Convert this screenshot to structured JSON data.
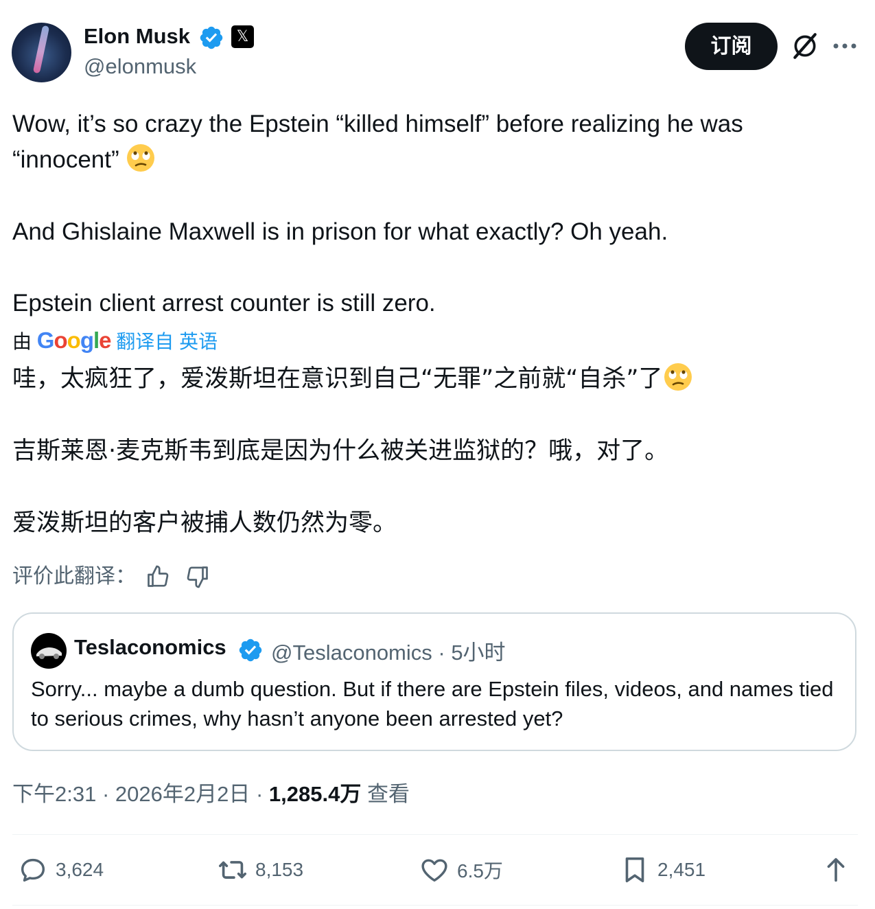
{
  "author": {
    "name": "Elon Musk",
    "handle": "@elonmusk",
    "subscribe_label": "订阅"
  },
  "tweet": {
    "line1": "Wow, it’s so crazy the Epstein “killed himself” before realizing he was",
    "line2": "“innocent”",
    "line3": "And Ghislaine Maxwell is in prison for what exactly? Oh yeah.",
    "line4": "Epstein client arrest counter is still zero."
  },
  "translation": {
    "by": "由",
    "provider": "Google",
    "link": "翻译自 英语",
    "line1": "哇，太疯狂了，爱泼斯坦在意识到自己“无罪”之前就“自杀”了",
    "line2": "吉斯莱恩·麦克斯韦到底是因为什么被关进监狱的？哦，对了。",
    "line3": "爱泼斯坦的客户被捕人数仍然为零。",
    "rate_label": "评价此翻译："
  },
  "quote": {
    "name": "Teslaconomics",
    "handle_time": "@Teslaconomics · 5小时",
    "text": "Sorry... maybe a dumb question. But if there are Epstein files, videos, and names tied to serious crimes, why hasn’t anyone been arrested yet?"
  },
  "meta": {
    "time_date": "下午2:31 · 2026年2月2日 · ",
    "views": "1,285.4万",
    "views_label": " 查看"
  },
  "actions": {
    "replies": "3,624",
    "reposts": "8,153",
    "likes": "6.5万",
    "bookmarks": "2,451"
  },
  "icons": [
    "verified-badge-icon",
    "x-logo-icon",
    "grok-icon",
    "more-icon",
    "thumbs-up-icon",
    "thumbs-down-icon",
    "reply-icon",
    "repost-icon",
    "like-icon",
    "bookmark-icon",
    "share-icon",
    "rolling-eyes-emoji"
  ],
  "colors": {
    "accent": "#1d9bf0",
    "text": "#0f1419",
    "muted": "#536471",
    "border": "#cfd9de"
  }
}
